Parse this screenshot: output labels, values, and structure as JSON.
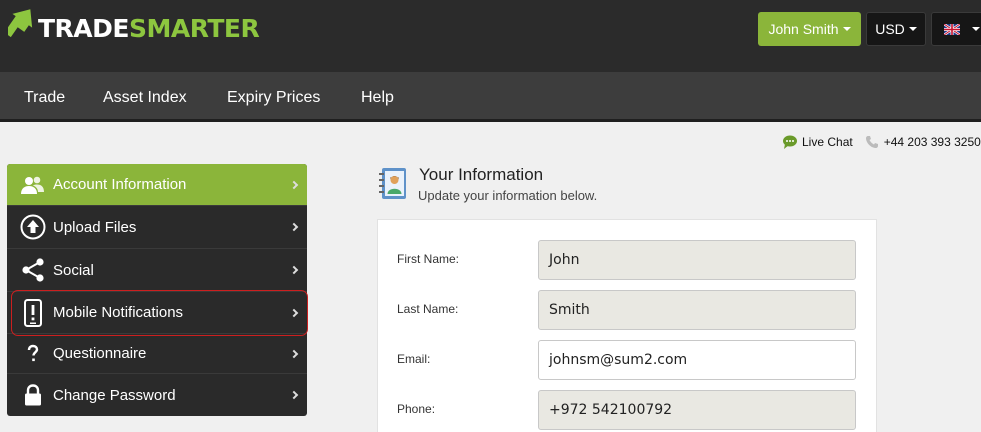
{
  "brand": {
    "trade": "TRADE",
    "smarter": "SMARTER",
    "accent": "#8dc63f"
  },
  "header": {
    "user_label": "John Smith",
    "currency_label": "USD",
    "language_flag": "uk-flag-icon"
  },
  "nav": {
    "items": [
      {
        "label": "Trade"
      },
      {
        "label": "Asset Index"
      },
      {
        "label": "Expiry Prices"
      },
      {
        "label": "Help"
      }
    ]
  },
  "contact": {
    "live_chat": "Live Chat",
    "phone": "+44 203 393 3250"
  },
  "sidebar": {
    "items": [
      {
        "label": "Account Information",
        "icon": "users-icon",
        "active": true
      },
      {
        "label": "Upload Files",
        "icon": "upload-icon"
      },
      {
        "label": "Social",
        "icon": "share-icon"
      },
      {
        "label": "Mobile Notifications",
        "icon": "mobile-alert-icon",
        "highlighted": true
      },
      {
        "label": "Questionnaire",
        "icon": "question-icon"
      },
      {
        "label": "Change Password",
        "icon": "lock-icon"
      }
    ]
  },
  "info": {
    "title": "Your Information",
    "subtitle": "Update your information below."
  },
  "form": {
    "fields": [
      {
        "label": "First Name:",
        "value": "John",
        "editable": false
      },
      {
        "label": "Last Name:",
        "value": "Smith",
        "editable": false
      },
      {
        "label": "Email:",
        "value": "johnsm@sum2.com",
        "editable": true
      },
      {
        "label": "Phone:",
        "value": "+972 542100792",
        "editable": false
      }
    ]
  },
  "colors": {
    "topbar": "#2b2b2b",
    "navbar": "#3d3d3d",
    "active_green": "#8bb53a",
    "highlight_red": "#cc1f1f"
  }
}
